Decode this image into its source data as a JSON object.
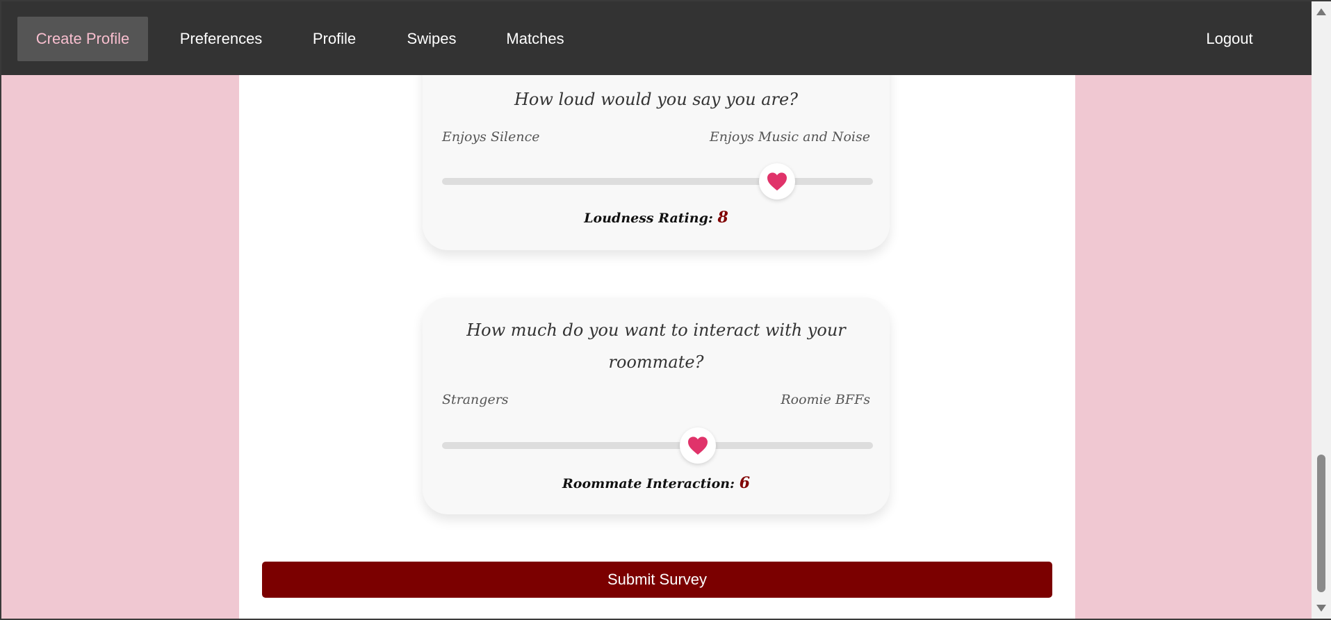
{
  "nav": {
    "items": [
      {
        "label": "Create Profile",
        "active": true
      },
      {
        "label": "Preferences"
      },
      {
        "label": "Profile"
      },
      {
        "label": "Swipes"
      },
      {
        "label": "Matches"
      }
    ],
    "logout": "Logout"
  },
  "survey": {
    "loudness": {
      "question": "How loud would you say you are?",
      "min_label": "Enjoys Silence",
      "max_label": "Enjoys Music and Noise",
      "value_label": "Loudness Rating:",
      "value": "8"
    },
    "interaction": {
      "question_line1": "How much do you want to interact with your",
      "question_line2": "roommate?",
      "min_label": "Strangers",
      "max_label": "Roomie BFFs",
      "value_label": "Roommate Interaction:",
      "value": "6"
    },
    "submit_label": "Submit Survey"
  },
  "colors": {
    "nav_bg": "#333333",
    "page_bg": "#f0c8d2",
    "accent_heart": "#e0336a",
    "submit_bg": "#7b0000",
    "active_nav_text": "#f8bfcf"
  },
  "icons": {
    "slider_thumb": "heart-icon"
  }
}
